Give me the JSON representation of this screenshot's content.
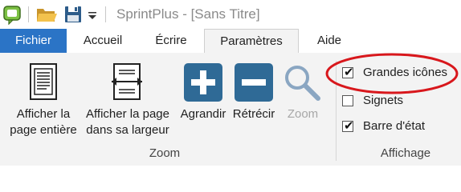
{
  "title_bar": {
    "text": "SprintPlus - [Sans Titre]",
    "icons": [
      "app-icon",
      "open-folder-icon",
      "save-disk-icon",
      "customize-dropdown-icon"
    ]
  },
  "tabs": [
    {
      "label": "Fichier",
      "state": "file-menu"
    },
    {
      "label": "Accueil",
      "state": "inactive"
    },
    {
      "label": "Écrire",
      "state": "inactive"
    },
    {
      "label": "Paramètres",
      "state": "active"
    },
    {
      "label": "Aide",
      "state": "inactive"
    }
  ],
  "ribbon": {
    "zoom_group": {
      "label": "Zoom",
      "buttons": [
        {
          "line1": "Afficher la",
          "line2": "page entière",
          "icon": "full-page-icon",
          "enabled": true
        },
        {
          "line1": "Afficher la page",
          "line2": "dans sa largeur",
          "icon": "page-width-icon",
          "enabled": true
        },
        {
          "line1": "Agrandir",
          "icon": "plus-icon",
          "enabled": true
        },
        {
          "line1": "Rétrécir",
          "icon": "minus-icon",
          "enabled": true
        },
        {
          "line1": "Zoom",
          "icon": "magnifier-icon",
          "enabled": false
        }
      ]
    },
    "display_group": {
      "label": "Affichage",
      "options": [
        {
          "label": "Grandes icônes",
          "checked": true,
          "checkmark": "✔"
        },
        {
          "label": "Signets",
          "checked": false,
          "checkmark": ""
        },
        {
          "label": "Barre d'état",
          "checked": true,
          "checkmark": "✔"
        }
      ]
    }
  },
  "colors": {
    "file_tab": "#2b74c6",
    "ribbon_bg": "#f3f3f3",
    "zoom_button_blue": "#2f6a96",
    "highlight_ellipse": "#d8171c",
    "disabled_text": "#a7a7a7"
  }
}
